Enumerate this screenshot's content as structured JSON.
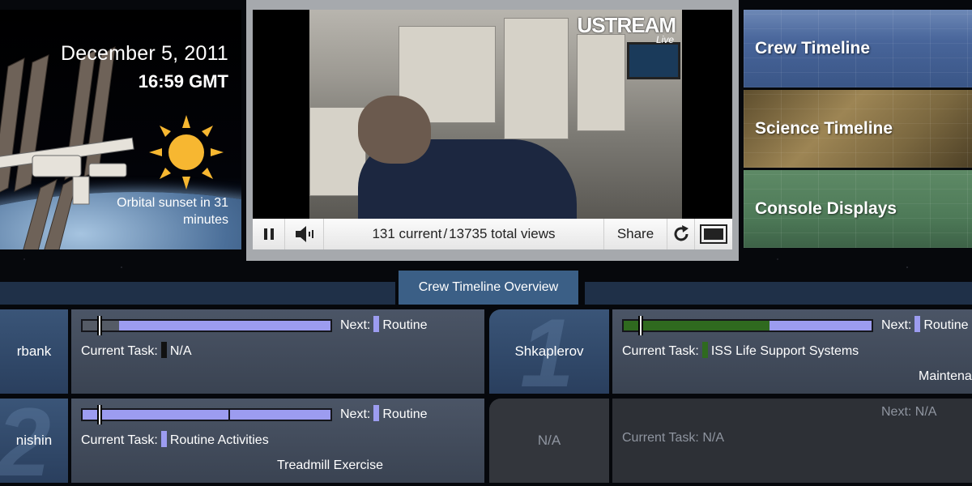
{
  "date_panel": {
    "date": "December 5, 2011",
    "time": "16:59 GMT",
    "sunset": "Orbital sunset in 31 minutes",
    "sun_color": "#f7b731"
  },
  "video": {
    "brand": "USTREAM",
    "brand_sub": "Live",
    "views_current": "131 current",
    "views_total": "13735 total views",
    "views_sep": "/",
    "share_label": "Share",
    "icons": {
      "pause": "pause-icon",
      "volume": "volume-icon",
      "reload": "reload-icon",
      "fullscreen": "fullscreen-icon"
    }
  },
  "tiles": [
    {
      "label": "Crew Timeline"
    },
    {
      "label": "Science Timeline"
    },
    {
      "label": "Console Displays"
    }
  ],
  "overview": {
    "title": "Crew Timeline Overview"
  },
  "crew": [
    {
      "name": "rbank",
      "next_prefix": "Next:",
      "next_task": "Routine",
      "next_color": "#9c9cf0",
      "current_prefix": "Current Task:",
      "current_task": "N/A",
      "current_color": "#111111",
      "after_task": "",
      "progress_fraction": 0.06
    },
    {
      "name": "Shkaplerov",
      "number": "1",
      "next_prefix": "Next:",
      "next_task": "Routine",
      "next_color": "#9c9cf0",
      "current_prefix": "Current Task:",
      "current_task": "ISS Life Support Systems",
      "current_color": "#2f6a1f",
      "after_task": "Maintena",
      "progress_fraction": 0.06
    },
    {
      "name": "nishin",
      "number": "2",
      "next_prefix": "Next:",
      "next_task": "Routine",
      "next_color": "#9c9cf0",
      "current_prefix": "Current Task:",
      "current_task": "Routine Activities",
      "current_color": "#9c9cf0",
      "after_task": "Treadmill Exercise",
      "progress_fraction": 0.06
    },
    {
      "name": "N/A",
      "next_prefix": "Next:",
      "next_task": "N/A",
      "current_prefix": "Current Task:",
      "current_task": "N/A"
    }
  ]
}
